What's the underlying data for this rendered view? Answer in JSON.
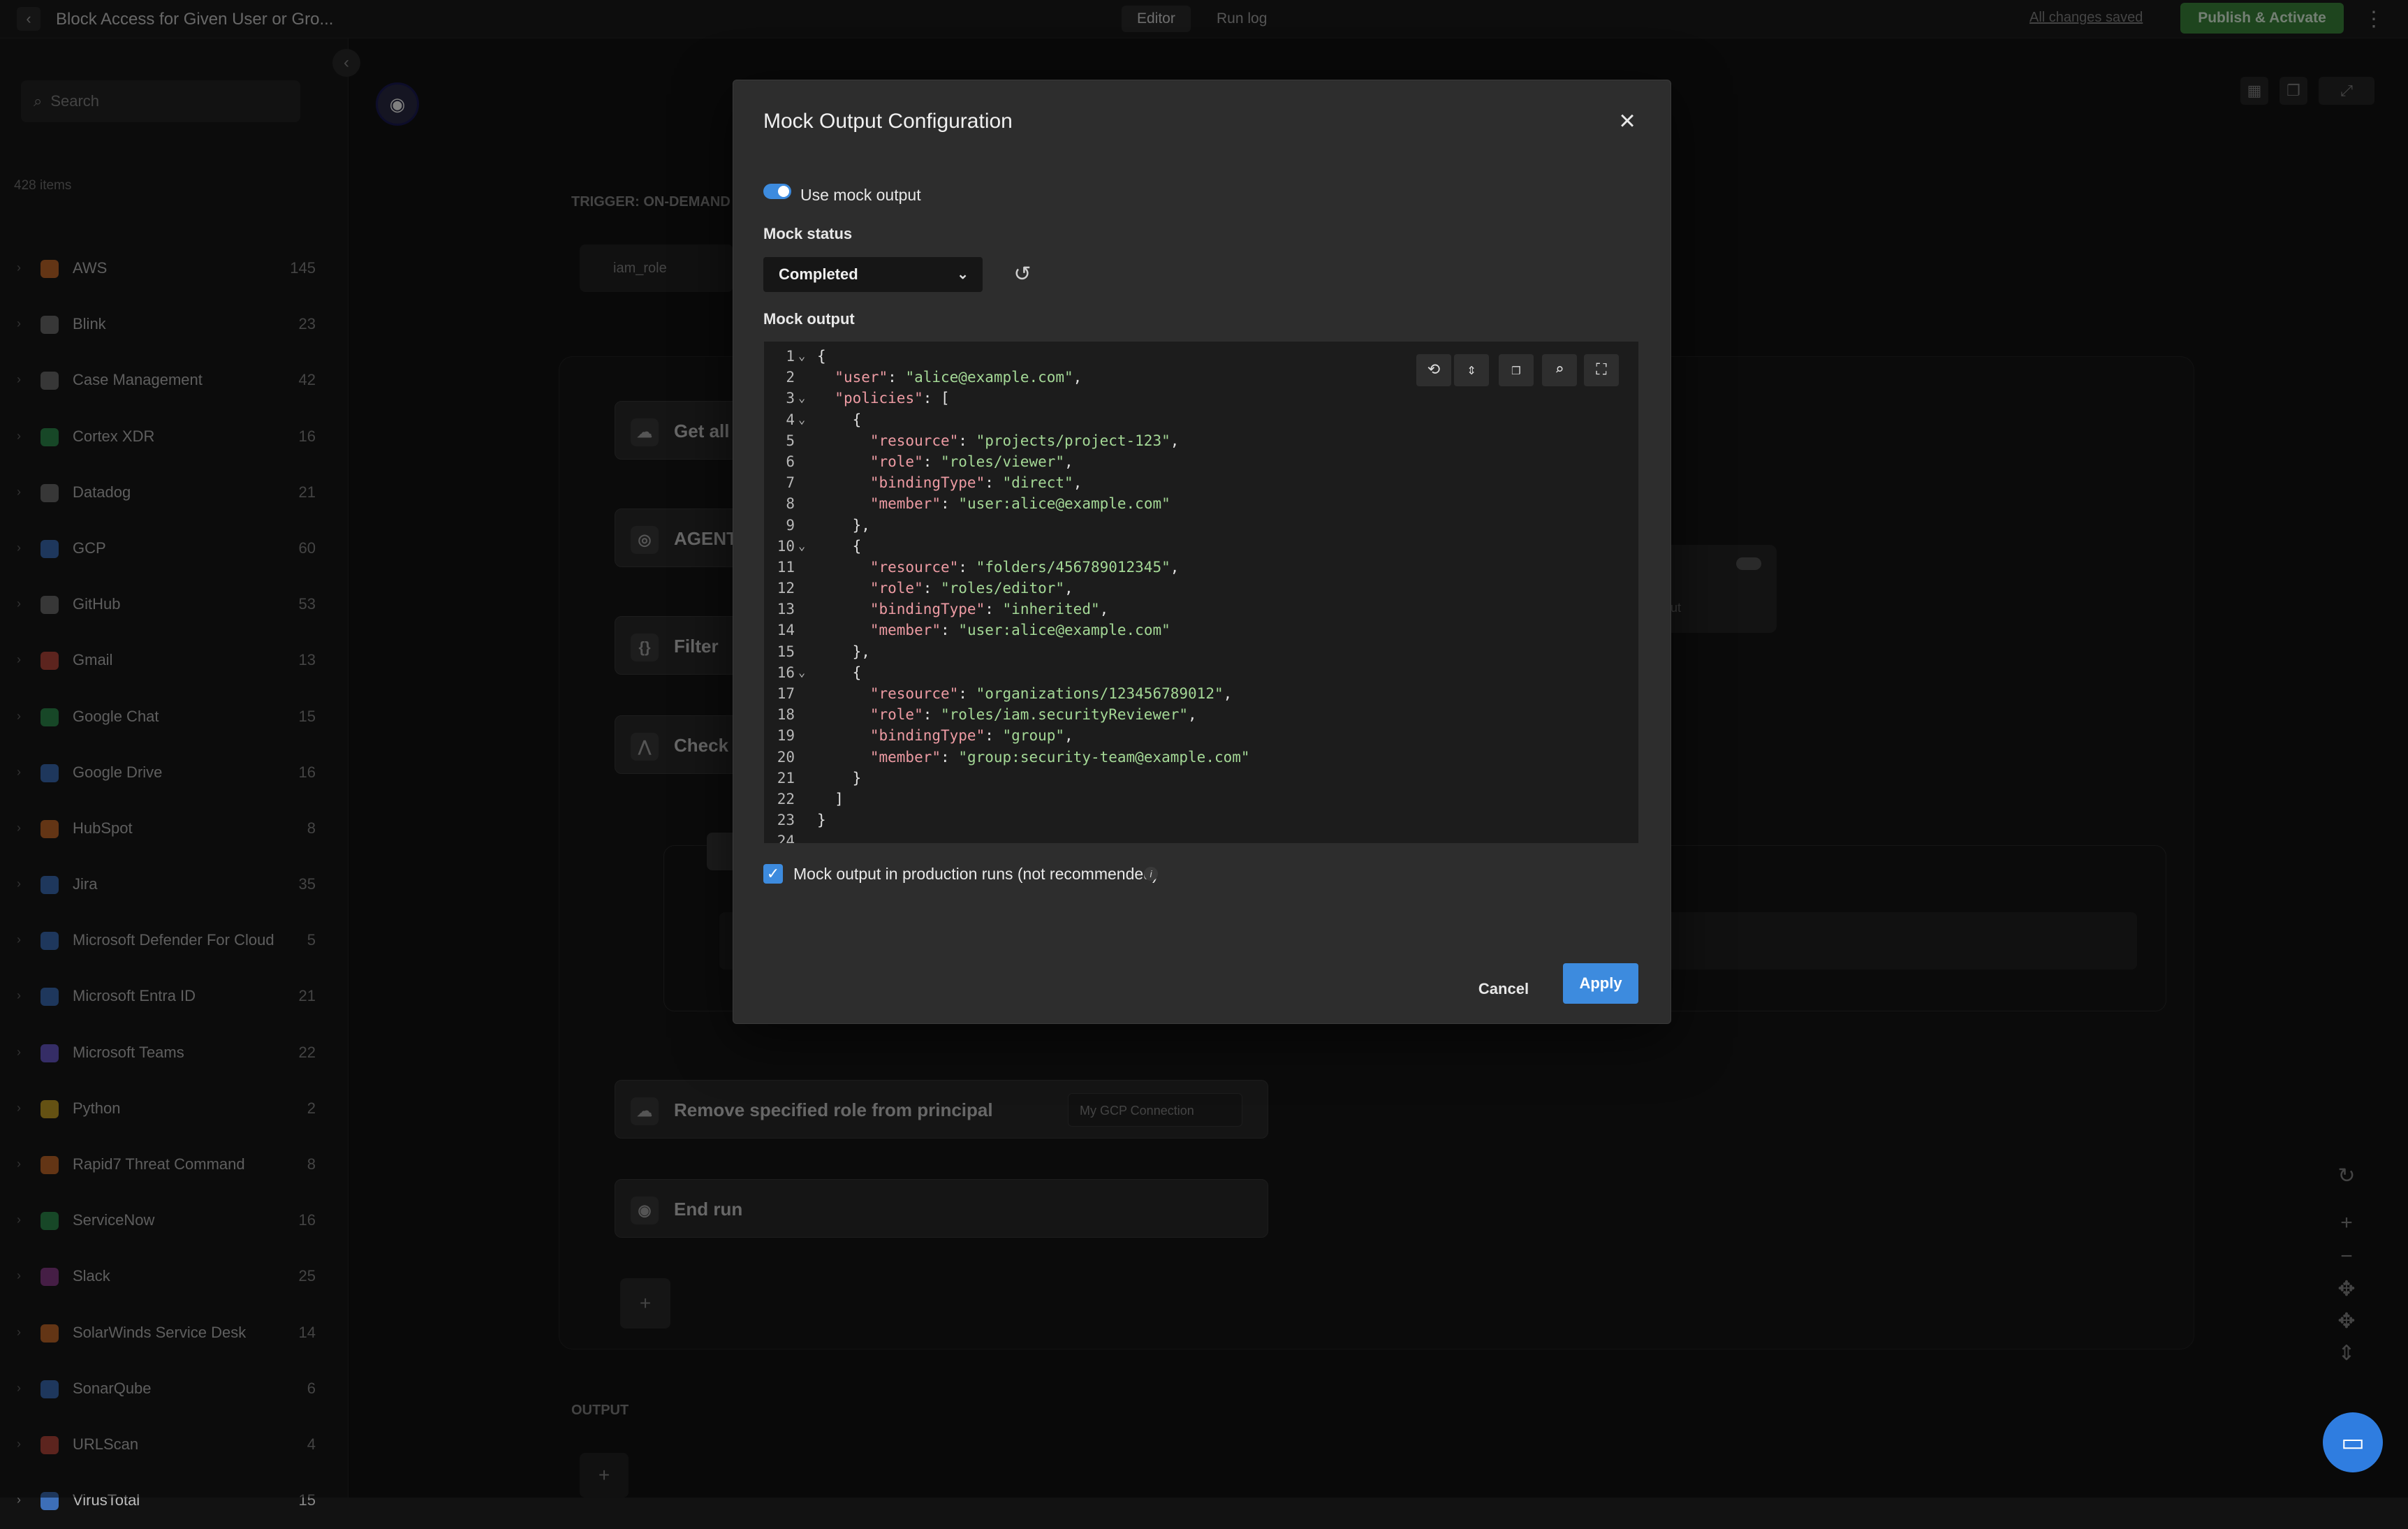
{
  "header": {
    "back_icon": "chevron-left-icon",
    "workflow_title": "Block Access for Given User or Gro...",
    "tabs": [
      {
        "label": "Editor",
        "active": true
      },
      {
        "label": "Run log",
        "active": false
      }
    ],
    "save_status": "All changes saved",
    "publish_label": "Publish & Activate",
    "more_icon": "kebab-icon"
  },
  "sidebar": {
    "search_placeholder": "Search",
    "item_count_label": "428 items",
    "integrations": [
      {
        "name": "AWS",
        "count": "145",
        "color": "#c66a2b"
      },
      {
        "name": "Blink",
        "count": "23",
        "color": "#6f6f6f"
      },
      {
        "name": "Case Management",
        "count": "42",
        "color": "#6f6f6f"
      },
      {
        "name": "Cortex XDR",
        "count": "16",
        "color": "#2f8f4f"
      },
      {
        "name": "Datadog",
        "count": "21",
        "color": "#6f6f6f"
      },
      {
        "name": "GCP",
        "count": "60",
        "color": "#3d6fb8"
      },
      {
        "name": "GitHub",
        "count": "53",
        "color": "#6f6f6f"
      },
      {
        "name": "Gmail",
        "count": "13",
        "color": "#b8483d"
      },
      {
        "name": "Google Chat",
        "count": "15",
        "color": "#2f8f4f"
      },
      {
        "name": "Google Drive",
        "count": "16",
        "color": "#3d6fb8"
      },
      {
        "name": "HubSpot",
        "count": "8",
        "color": "#c66a2b"
      },
      {
        "name": "Jira",
        "count": "35",
        "color": "#3d6fb8"
      },
      {
        "name": "Microsoft Defender For Cloud",
        "count": "5",
        "color": "#3d6fb8"
      },
      {
        "name": "Microsoft Entra ID",
        "count": "21",
        "color": "#3d6fb8"
      },
      {
        "name": "Microsoft Teams",
        "count": "22",
        "color": "#6a5acd"
      },
      {
        "name": "Python",
        "count": "2",
        "color": "#c9a227"
      },
      {
        "name": "Rapid7 Threat Command",
        "count": "8",
        "color": "#c66a2b"
      },
      {
        "name": "ServiceNow",
        "count": "16",
        "color": "#2f8f4f"
      },
      {
        "name": "Slack",
        "count": "25",
        "color": "#8a3d8a"
      },
      {
        "name": "SolarWinds Service Desk",
        "count": "14",
        "color": "#c66a2b"
      },
      {
        "name": "SonarQube",
        "count": "6",
        "color": "#3d6fb8"
      },
      {
        "name": "URLScan",
        "count": "4",
        "color": "#b8483d"
      },
      {
        "name": "VirusTotal",
        "count": "15",
        "color": "#3d6fb8"
      }
    ]
  },
  "canvas": {
    "trigger_label": "TRIGGER: ON-DEMAND",
    "trigger_param": "iam_role",
    "steps": [
      {
        "label": "Get all"
      },
      {
        "label": "AGENT"
      },
      {
        "label": "Filter"
      },
      {
        "label": "Check"
      },
      {
        "label": "Remove specified role from principal",
        "connection": "My GCP Connection"
      },
      {
        "label": "End run"
      }
    ],
    "output_label": "OUTPUT",
    "partial_text": "out"
  },
  "modal": {
    "title": "Mock Output Configuration",
    "use_mock_label": "Use mock output",
    "use_mock_enabled": true,
    "mock_status_label": "Mock status",
    "mock_status_value": "Completed",
    "mock_output_label": "Mock output",
    "code_lines": [
      {
        "n": "1",
        "fold": true,
        "indent": "",
        "key": "",
        "value": "",
        "tail": "{"
      },
      {
        "n": "2",
        "fold": false,
        "indent": "  ",
        "key": "\"user\"",
        "value": "\"alice@example.com\"",
        "tail": ","
      },
      {
        "n": "3",
        "fold": true,
        "indent": "  ",
        "key": "\"policies\"",
        "value": "",
        "tail": ": ["
      },
      {
        "n": "4",
        "fold": true,
        "indent": "    ",
        "key": "",
        "value": "",
        "tail": "{"
      },
      {
        "n": "5",
        "fold": false,
        "indent": "      ",
        "key": "\"resource\"",
        "value": "\"projects/project-123\"",
        "tail": ","
      },
      {
        "n": "6",
        "fold": false,
        "indent": "      ",
        "key": "\"role\"",
        "value": "\"roles/viewer\"",
        "tail": ","
      },
      {
        "n": "7",
        "fold": false,
        "indent": "      ",
        "key": "\"bindingType\"",
        "value": "\"direct\"",
        "tail": ","
      },
      {
        "n": "8",
        "fold": false,
        "indent": "      ",
        "key": "\"member\"",
        "value": "\"user:alice@example.com\"",
        "tail": ""
      },
      {
        "n": "9",
        "fold": false,
        "indent": "    ",
        "key": "",
        "value": "",
        "tail": "},"
      },
      {
        "n": "10",
        "fold": true,
        "indent": "    ",
        "key": "",
        "value": "",
        "tail": "{"
      },
      {
        "n": "11",
        "fold": false,
        "indent": "      ",
        "key": "\"resource\"",
        "value": "\"folders/456789012345\"",
        "tail": ","
      },
      {
        "n": "12",
        "fold": false,
        "indent": "      ",
        "key": "\"role\"",
        "value": "\"roles/editor\"",
        "tail": ","
      },
      {
        "n": "13",
        "fold": false,
        "indent": "      ",
        "key": "\"bindingType\"",
        "value": "\"inherited\"",
        "tail": ","
      },
      {
        "n": "14",
        "fold": false,
        "indent": "      ",
        "key": "\"member\"",
        "value": "\"user:alice@example.com\"",
        "tail": ""
      },
      {
        "n": "15",
        "fold": false,
        "indent": "    ",
        "key": "",
        "value": "",
        "tail": "},"
      },
      {
        "n": "16",
        "fold": true,
        "indent": "    ",
        "key": "",
        "value": "",
        "tail": "{"
      },
      {
        "n": "17",
        "fold": false,
        "indent": "      ",
        "key": "\"resource\"",
        "value": "\"organizations/123456789012\"",
        "tail": ","
      },
      {
        "n": "18",
        "fold": false,
        "indent": "      ",
        "key": "\"role\"",
        "value": "\"roles/iam.securityReviewer\"",
        "tail": ","
      },
      {
        "n": "19",
        "fold": false,
        "indent": "      ",
        "key": "\"bindingType\"",
        "value": "\"group\"",
        "tail": ","
      },
      {
        "n": "20",
        "fold": false,
        "indent": "      ",
        "key": "\"member\"",
        "value": "\"group:security-team@example.com\"",
        "tail": ""
      },
      {
        "n": "21",
        "fold": false,
        "indent": "    ",
        "key": "",
        "value": "",
        "tail": "}"
      },
      {
        "n": "22",
        "fold": false,
        "indent": "  ",
        "key": "",
        "value": "",
        "tail": "]"
      },
      {
        "n": "23",
        "fold": false,
        "indent": "",
        "key": "",
        "value": "",
        "tail": "}"
      },
      {
        "n": "24",
        "fold": false,
        "indent": "",
        "key": "",
        "value": "",
        "tail": ""
      }
    ],
    "editor_tools": [
      "format-icon",
      "collapse-all-icon",
      "copy-icon",
      "search-icon",
      "fullscreen-icon"
    ],
    "production_label": "Mock output in production runs (not recommended)",
    "production_checked": true,
    "cancel_label": "Cancel",
    "apply_label": "Apply",
    "accent_color": "#3d8bde"
  }
}
